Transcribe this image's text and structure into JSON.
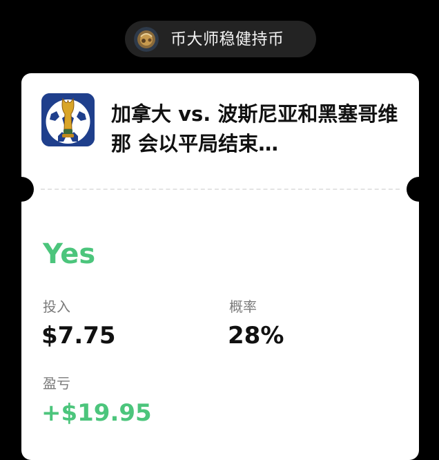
{
  "header": {
    "username": "币大师稳健持币",
    "avatar_icon": "user-avatar-photo"
  },
  "card": {
    "app_icon": "world-cup-trophy-soccer-ball-icon",
    "title": "加拿大 vs. 波斯尼亚和黑塞哥维那 会以平局结束…",
    "outcome": "Yes",
    "invested_label": "投入",
    "invested_value": "$7.75",
    "probability_label": "概率",
    "probability_value": "28%",
    "pnl_label": "盈亏",
    "pnl_value": "+$19.95"
  },
  "colors": {
    "background": "#000000",
    "pill": "#232323",
    "card": "#ffffff",
    "accent_green": "#4cc57c",
    "icon_blue": "#1f3f8c",
    "label_gray": "#7a7a7a"
  }
}
